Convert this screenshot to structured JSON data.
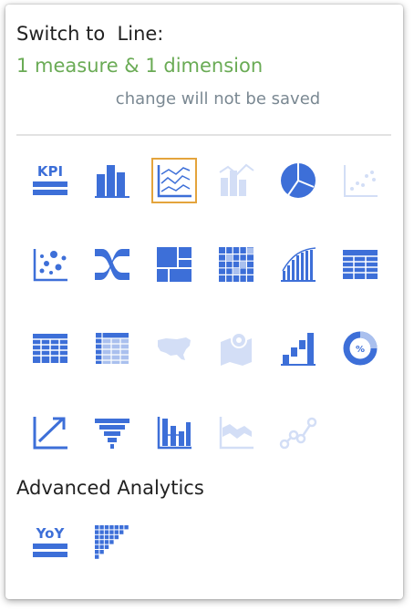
{
  "header": {
    "switch_to": "Switch to  Line:",
    "requirement": "1 measure & 1 dimension",
    "note": "change will not be saved"
  },
  "colors": {
    "icon": "#3d6fd8",
    "selected_border": "#e4a43c",
    "requirement": "#6aab55"
  },
  "charts": [
    {
      "icon": "kpi-icon",
      "label": "KPI",
      "enabled": true
    },
    {
      "icon": "bar-chart-icon",
      "enabled": true
    },
    {
      "icon": "line-chart-icon",
      "enabled": true,
      "selected": true
    },
    {
      "icon": "combo-chart-icon",
      "enabled": false
    },
    {
      "icon": "pie-chart-icon",
      "enabled": true
    },
    {
      "icon": "scatter-plot-icon",
      "enabled": false
    },
    {
      "icon": "bubble-chart-icon",
      "enabled": true
    },
    {
      "icon": "sankey-icon",
      "enabled": true
    },
    {
      "icon": "treemap-icon",
      "enabled": true
    },
    {
      "icon": "heatmap-icon",
      "enabled": true
    },
    {
      "icon": "pareto-icon",
      "enabled": true
    },
    {
      "icon": "table-icon",
      "enabled": true
    },
    {
      "icon": "pivot-table-icon",
      "enabled": true
    },
    {
      "icon": "sticky-table-icon",
      "enabled": true
    },
    {
      "icon": "us-map-icon",
      "enabled": false
    },
    {
      "icon": "geo-map-icon",
      "enabled": false
    },
    {
      "icon": "waterfall-icon",
      "enabled": true
    },
    {
      "icon": "donut-percent-icon",
      "label": "%",
      "enabled": true
    },
    {
      "icon": "trend-arrow-icon",
      "enabled": true
    },
    {
      "icon": "funnel-icon",
      "enabled": true
    },
    {
      "icon": "boxplot-icon",
      "enabled": true
    },
    {
      "icon": "area-chart-icon",
      "enabled": false
    },
    {
      "icon": "network-line-icon",
      "enabled": false
    }
  ],
  "advanced": {
    "title": "Advanced Analytics",
    "items": [
      {
        "icon": "yoy-icon",
        "label": "YoY",
        "enabled": true
      },
      {
        "icon": "cohort-icon",
        "enabled": true
      }
    ]
  }
}
